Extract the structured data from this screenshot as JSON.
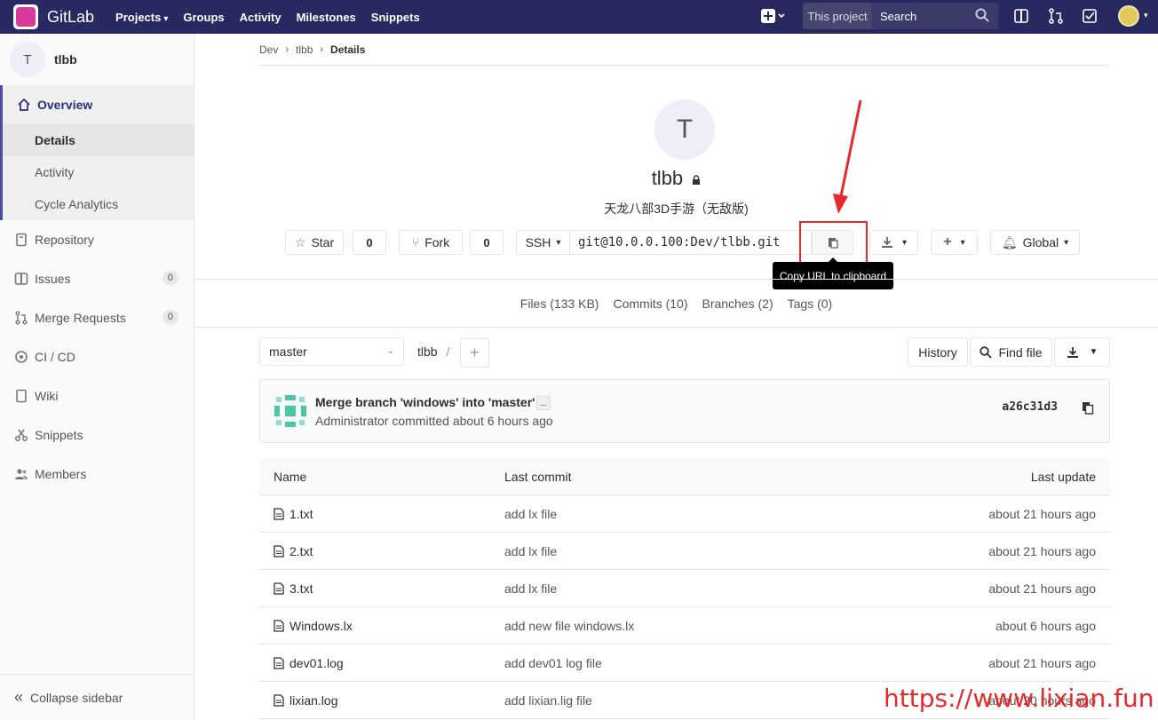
{
  "navbar": {
    "brand": "GitLab",
    "links": [
      "Projects",
      "Groups",
      "Activity",
      "Milestones",
      "Snippets"
    ],
    "search_scope": "This project",
    "search_placeholder": "Search"
  },
  "sidebar": {
    "project_initial": "T",
    "project_name": "tlbb",
    "overview": "Overview",
    "overview_sub": [
      "Details",
      "Activity",
      "Cycle Analytics"
    ],
    "items": [
      {
        "label": "Repository"
      },
      {
        "label": "Issues",
        "count": "0"
      },
      {
        "label": "Merge Requests",
        "count": "0"
      },
      {
        "label": "CI / CD"
      },
      {
        "label": "Wiki"
      },
      {
        "label": "Snippets"
      },
      {
        "label": "Members"
      }
    ],
    "collapse": "Collapse sidebar"
  },
  "breadcrumb": [
    "Dev",
    "tlbb",
    "Details"
  ],
  "project": {
    "initial": "T",
    "name": "tlbb",
    "description": "天龙八部3D手游（无敌版)",
    "star_label": "Star",
    "star_count": "0",
    "fork_label": "Fork",
    "fork_count": "0",
    "protocol": "SSH",
    "clone_url": "git@10.0.0.100:Dev/tlbb.git",
    "tooltip": "Copy URL to clipboard",
    "notification": "Global"
  },
  "stats": [
    "Files (133 KB)",
    "Commits (10)",
    "Branches (2)",
    "Tags (0)"
  ],
  "repo": {
    "branch": "master",
    "path": "tlbb",
    "history": "History",
    "find_file": "Find file"
  },
  "commit": {
    "title": "Merge branch 'windows' into 'master'",
    "ellipsis": "...",
    "meta": "Administrator committed about 6 hours ago",
    "sha": "a26c31d3"
  },
  "files": {
    "headers": [
      "Name",
      "Last commit",
      "Last update"
    ],
    "rows": [
      {
        "name": "1.txt",
        "commit": "add lx file",
        "updated": "about 21 hours ago"
      },
      {
        "name": "2.txt",
        "commit": "add lx file",
        "updated": "about 21 hours ago"
      },
      {
        "name": "3.txt",
        "commit": "add lx file",
        "updated": "about 21 hours ago"
      },
      {
        "name": "Windows.lx",
        "commit": "add new file windows.lx",
        "updated": "about 6 hours ago"
      },
      {
        "name": "dev01.log",
        "commit": "add dev01 log file",
        "updated": "about 21 hours ago"
      },
      {
        "name": "lixian.log",
        "commit": "add lixian.lig file",
        "updated": "about 20 hours ago"
      }
    ]
  },
  "watermark": "https://www.lixian.fun",
  "colors": {
    "navbar": "#292961",
    "annotation": "#e8282b"
  }
}
